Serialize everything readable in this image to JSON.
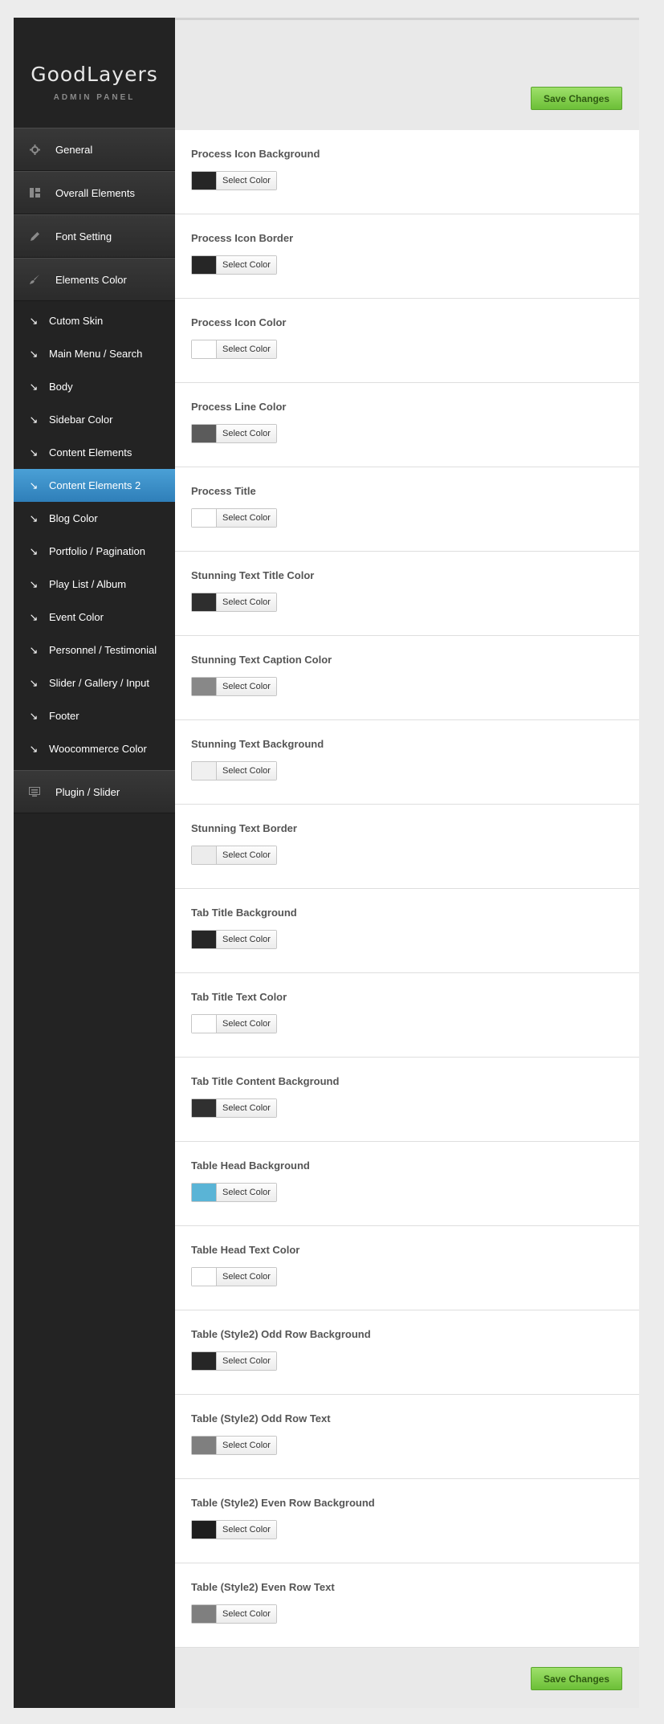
{
  "logo": {
    "title": "GoodLayers",
    "subtitle": "ADMIN PANEL"
  },
  "menu": {
    "general": "General",
    "overall": "Overall Elements",
    "font": "Font Setting",
    "colors": "Elements Color",
    "plugin": "Plugin / Slider"
  },
  "submenu": [
    "Cutom Skin",
    "Main Menu / Search",
    "Body",
    "Sidebar Color",
    "Content Elements",
    "Content Elements 2",
    "Blog Color",
    "Portfolio / Pagination",
    "Play List / Album",
    "Event Color",
    "Personnel / Testimonial",
    "Slider / Gallery / Input",
    "Footer",
    "Woocommerce Color"
  ],
  "active_submenu": "Content Elements 2",
  "actions": {
    "save_top": "Save Changes",
    "save_bottom": "Save Changes",
    "select_color": "Select Color"
  },
  "fields": [
    {
      "label": "Process Icon Background",
      "color": "#262626"
    },
    {
      "label": "Process Icon Border",
      "color": "#262626"
    },
    {
      "label": "Process Icon Color",
      "color": "#ffffff"
    },
    {
      "label": "Process Line Color",
      "color": "#5b5b5b"
    },
    {
      "label": "Process Title",
      "color": "#ffffff"
    },
    {
      "label": "Stunning Text Title Color",
      "color": "#2e2e2e"
    },
    {
      "label": "Stunning Text Caption Color",
      "color": "#888888"
    },
    {
      "label": "Stunning Text Background",
      "color": "#f0f0f0"
    },
    {
      "label": "Stunning Text Border",
      "color": "#ececec"
    },
    {
      "label": "Tab Title Background",
      "color": "#262626"
    },
    {
      "label": "Tab Title Text Color",
      "color": "#ffffff"
    },
    {
      "label": "Tab Title Content Background",
      "color": "#303030"
    },
    {
      "label": "Table Head Background",
      "color": "#5ab4d6"
    },
    {
      "label": "Table Head Text Color",
      "color": "#ffffff"
    },
    {
      "label": "Table (Style2) Odd Row Background",
      "color": "#262626"
    },
    {
      "label": "Table (Style2) Odd Row Text",
      "color": "#7f7f7f"
    },
    {
      "label": "Table (Style2) Even Row Background",
      "color": "#1e1e1e"
    },
    {
      "label": "Table (Style2) Even Row Text",
      "color": "#7f7f7f"
    }
  ]
}
